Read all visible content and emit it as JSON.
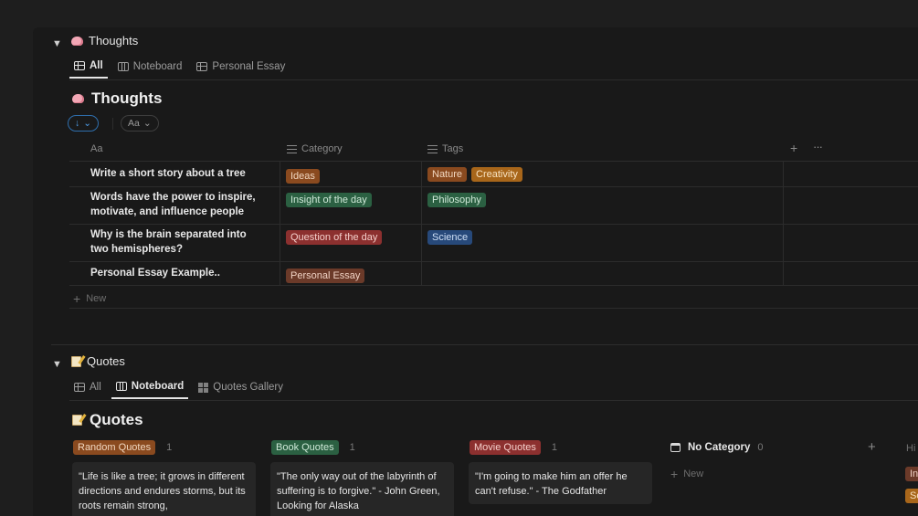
{
  "thoughts_section": {
    "toggle": "▼",
    "title": "Thoughts",
    "tabs": [
      {
        "label": "All"
      },
      {
        "label": "Noteboard"
      },
      {
        "label": "Personal Essay"
      }
    ],
    "db_title": "Thoughts",
    "sort_label": "↓",
    "filter_label": "Aa",
    "columns": {
      "name": "Aa",
      "category": "Category",
      "tags": "Tags"
    },
    "rows": [
      {
        "name": "Write a short story about a tree",
        "category": "Ideas",
        "tags": [
          "Nature",
          "Creativity"
        ]
      },
      {
        "name": "Words have the power to inspire, motivate, and influence people",
        "category": "Insight of the day",
        "tags": [
          "Philosophy"
        ]
      },
      {
        "name": "Why is the brain separated into two hemispheres?",
        "category": "Question of the day",
        "tags": [
          "Science"
        ]
      },
      {
        "name": "Personal Essay Example..",
        "category": "Personal Essay",
        "tags": []
      }
    ],
    "new_label": "New"
  },
  "quotes_section": {
    "toggle": "▼",
    "title": "Quotes",
    "tabs": [
      {
        "label": "All"
      },
      {
        "label": "Noteboard"
      },
      {
        "label": "Quotes Gallery"
      }
    ],
    "db_title": "Quotes",
    "groups": [
      {
        "label": "Random Quotes",
        "count": "1",
        "card": "\"Life is like a tree; it grows in different directions and endures storms, but its roots remain strong,"
      },
      {
        "label": "Book Quotes",
        "count": "1",
        "card": "\"The only way out of the labyrinth of suffering is to forgive.\" - John Green, Looking for Alaska"
      },
      {
        "label": "Movie Quotes",
        "count": "1",
        "card": "\"I'm going to make him an offer he can't refuse.\" - The Godfather"
      },
      {
        "label": "No Category",
        "count": "0"
      }
    ],
    "new_label": "New",
    "hidden_label": "Hi",
    "hidden_tags": [
      "In",
      "Sc"
    ]
  },
  "colors": {
    "background": "#191919",
    "accent": "#4d9de8"
  }
}
